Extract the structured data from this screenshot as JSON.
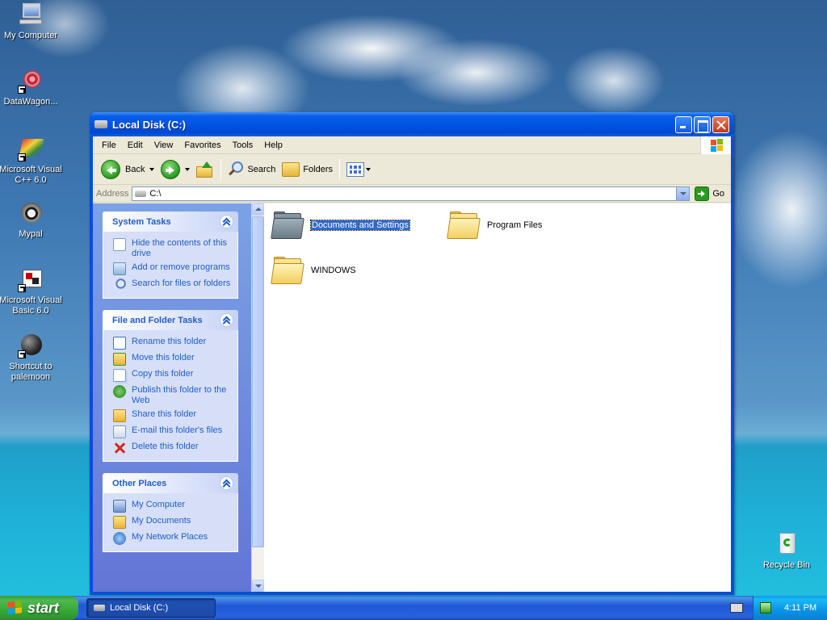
{
  "desktop": {
    "icons": [
      {
        "label": "My Computer",
        "icon": "my-computer-icon"
      },
      {
        "label": "DataWagon...",
        "icon": "datawagon-icon"
      },
      {
        "label": "Microsoft Visual C++ 6.0",
        "icon": "visual-cpp-icon"
      },
      {
        "label": "Mypal",
        "icon": "mypal-icon"
      },
      {
        "label": "Microsoft Visual Basic 6.0",
        "icon": "visual-basic-icon"
      },
      {
        "label": "Shortcut to palemoon",
        "icon": "palemoon-icon"
      },
      {
        "label": "Recycle Bin",
        "icon": "recycle-bin-icon"
      }
    ]
  },
  "window": {
    "title": "Local Disk (C:)",
    "menu": [
      "File",
      "Edit",
      "View",
      "Favorites",
      "Tools",
      "Help"
    ],
    "toolbar": {
      "back": "Back",
      "search": "Search",
      "folders": "Folders"
    },
    "address": {
      "label": "Address",
      "value": "C:\\",
      "go": "Go"
    },
    "taskpane": {
      "system_tasks": {
        "title": "System Tasks",
        "items": [
          "Hide the contents of this drive",
          "Add or remove programs",
          "Search for files or folders"
        ]
      },
      "file_folder_tasks": {
        "title": "File and Folder Tasks",
        "items": [
          "Rename this folder",
          "Move this folder",
          "Copy this folder",
          "Publish this folder to the Web",
          "Share this folder",
          "E-mail this folder's files",
          "Delete this folder"
        ]
      },
      "other_places": {
        "title": "Other Places",
        "items": [
          "My Computer",
          "My Documents",
          "My Network Places"
        ]
      }
    },
    "files": [
      {
        "name": "Documents and Settings",
        "selected": true
      },
      {
        "name": "Program Files",
        "selected": false
      },
      {
        "name": "WINDOWS",
        "selected": false
      }
    ]
  },
  "taskbar": {
    "start": "start",
    "task_button": "Local Disk (C:)",
    "clock": "4:11 PM"
  }
}
